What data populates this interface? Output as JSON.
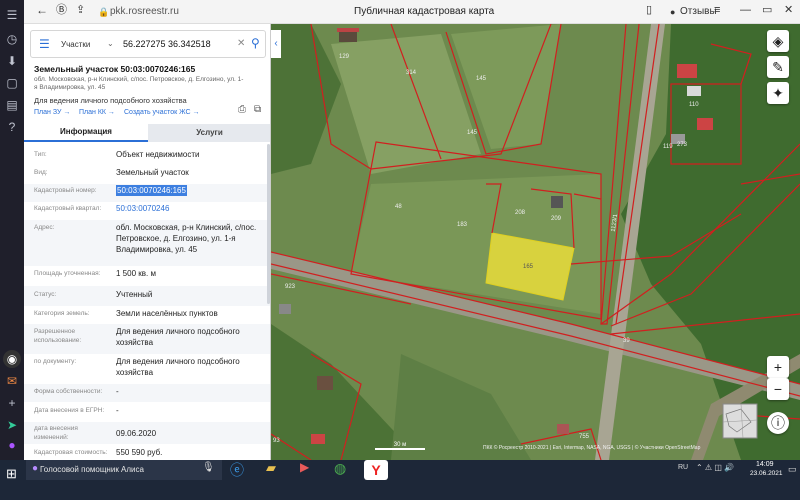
{
  "browser": {
    "url": "pkk.rosreestr.ru",
    "title": "Публичная кадастровая карта",
    "reviews_label": "Отзывы"
  },
  "search": {
    "category": "Участки",
    "query": "56.227275 36.342518"
  },
  "parcel": {
    "heading": "Земельный участок 50:03:0070246:165",
    "address_line": "обл. Московская, р-н Клинский, с/пос. Петровское, д. Елгозино, ул. 1-я Владимировка, ул. 45",
    "purpose_line": "Для ведения личного подсобного хозяйства",
    "links": [
      "План ЗУ →",
      "План КК →",
      "Создать участок ЖС →"
    ]
  },
  "tabs": [
    "Информация",
    "Услуги"
  ],
  "info_rows": [
    {
      "label": "Тип:",
      "value": "Объект недвижимости"
    },
    {
      "label": "Вид:",
      "value": "Земельный участок"
    },
    {
      "label": "Кадастровый номер:",
      "value": "50:03:0070246:165"
    },
    {
      "label": "Кадастровый квартал:",
      "value": "50:03:0070246"
    },
    {
      "label": "Адрес:",
      "value": "обл. Московская, р-н Клинский, с/пос. Петровское, д. Елгозино, ул. 1-я Владимировка, ул. 45"
    },
    {
      "label": "Площадь уточненная:",
      "value": "1 500 кв. м"
    },
    {
      "label": "Статус:",
      "value": "Учтенный"
    },
    {
      "label": "Категория земель:",
      "value": "Земли населённых пунктов"
    },
    {
      "label": "Разрешенное использование:",
      "value": "Для ведения личного подсобного хозяйства"
    },
    {
      "label": "по документу:",
      "value": "Для ведения личного подсобного хозяйства"
    },
    {
      "label": "Форма собственности:",
      "value": "-"
    },
    {
      "label": "Дата внесения в ЕГРН:",
      "value": "-"
    },
    {
      "label": "дата внесения изменений:",
      "value": "09.06.2020"
    },
    {
      "label": "Кадастровая стоимость:",
      "value": "550 590 руб."
    }
  ],
  "map_labels": [
    "129",
    "314",
    "145",
    "145",
    "48",
    "183",
    "208",
    "209",
    "165",
    "110",
    "119",
    "273",
    "923",
    "39",
    "755",
    "93",
    "1123/1"
  ],
  "map": {
    "scale": "30 м",
    "attribution": "ПКК © Росреестр 2010-2021 | Esri, Intermap, NASA, NGA, USGS | © Участники OpenStreetMap"
  },
  "taskbar": {
    "assistant": "Голосовой помощник Алиса",
    "lang": "RU",
    "time": "14:09",
    "date": "23.06.2021"
  },
  "colors": {
    "selection": "#e9dc3a",
    "boundary": "#d11f1f",
    "accent": "#2b6fd6"
  }
}
